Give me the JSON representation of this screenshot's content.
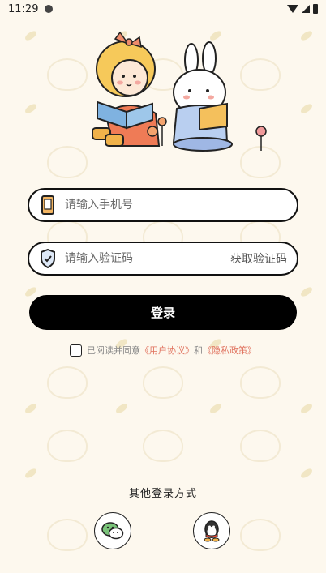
{
  "status_bar": {
    "time": "11:29"
  },
  "login_form": {
    "phone_placeholder": "请输入手机号",
    "code_placeholder": "请输入验证码",
    "get_code_label": "获取验证码",
    "login_label": "登录"
  },
  "agreement": {
    "prefix": "已阅读并同意",
    "user_agreement": "《用户协议》",
    "and": "和",
    "privacy_policy": "《隐私政策》"
  },
  "other_login": {
    "title": "—— 其他登录方式 ——",
    "methods": [
      "wechat",
      "qq"
    ]
  },
  "colors": {
    "background": "#fdf8ee",
    "accent_link": "#e0705c",
    "button": "#000000"
  }
}
